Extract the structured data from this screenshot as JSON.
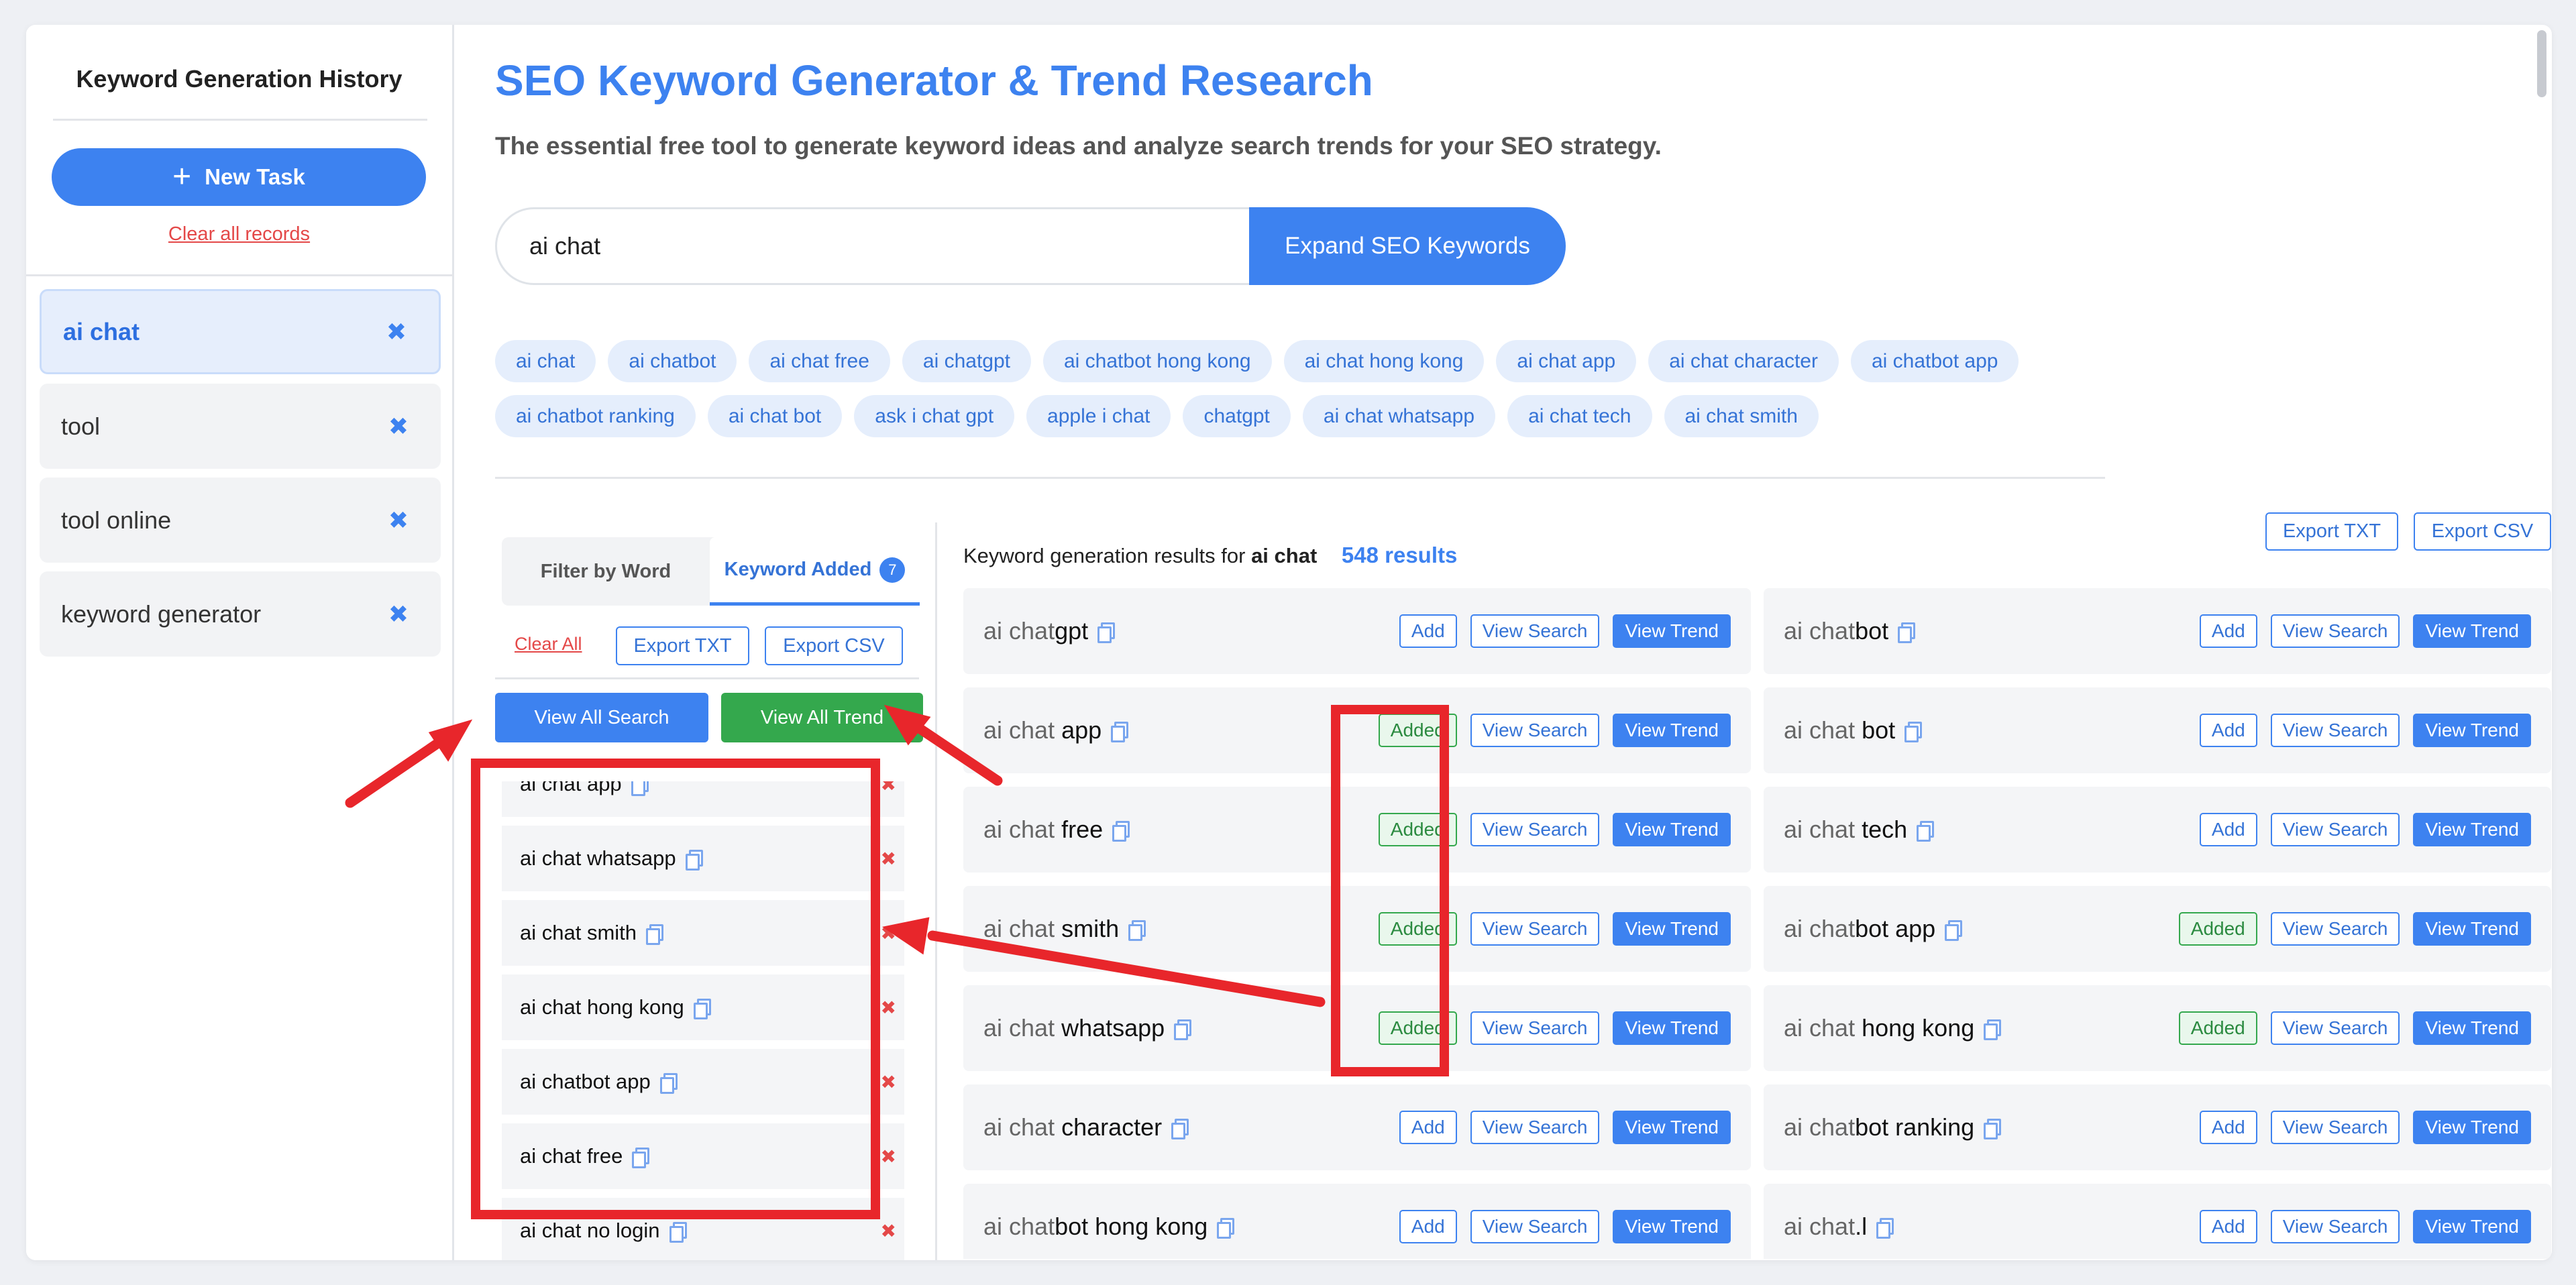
{
  "sidebar": {
    "title": "Keyword Generation History",
    "new_task_label": "New Task",
    "clear_all_label": "Clear all records",
    "items": [
      {
        "label": "ai chat"
      },
      {
        "label": "tool"
      },
      {
        "label": "tool online"
      },
      {
        "label": "keyword generator"
      }
    ]
  },
  "header": {
    "title": "SEO Keyword Generator & Trend Research",
    "subtitle": "The essential free tool to generate keyword ideas and analyze search trends for your SEO strategy."
  },
  "search": {
    "value": "ai chat",
    "button_label": "Expand SEO Keywords"
  },
  "chips": {
    "row1": [
      "ai chat",
      "ai chatbot",
      "ai chat free",
      "ai chatgpt",
      "ai chatbot hong kong",
      "ai chat hong kong",
      "ai chat app",
      "ai chat character",
      "ai chatbot app"
    ],
    "row2": [
      "ai chatbot ranking",
      "ai chat bot",
      "ask i chat gpt",
      "apple i chat",
      "chatgpt",
      "ai chat whatsapp",
      "ai chat tech",
      "ai chat smith"
    ]
  },
  "keyword_panel": {
    "tab_filter": "Filter by Word",
    "tab_added": "Keyword Added",
    "added_count": "7",
    "clear_all": "Clear All",
    "export_txt": "Export TXT",
    "export_csv": "Export CSV",
    "view_all_search": "View All Search",
    "view_all_trend": "View All Trend",
    "added_items": [
      "ai chat app",
      "ai chat whatsapp",
      "ai chat smith",
      "ai chat hong kong",
      "ai chatbot app",
      "ai chat free",
      "ai chat no login"
    ]
  },
  "results": {
    "prefix": "Keyword generation results for",
    "query": "ai chat",
    "count": "548 results",
    "export_txt": "Export TXT",
    "export_csv": "Export CSV",
    "labels": {
      "add": "Add",
      "added": "Added",
      "view_search": "View Search",
      "view_trend": "View Trend"
    },
    "left": [
      {
        "base": "ai chat",
        "rest": "gpt",
        "added": false
      },
      {
        "base": "ai chat",
        "rest": " app",
        "added": true
      },
      {
        "base": "ai chat",
        "rest": " free",
        "added": true
      },
      {
        "base": "ai chat",
        "rest": " smith",
        "added": true
      },
      {
        "base": "ai chat",
        "rest": " whatsapp",
        "added": true
      },
      {
        "base": "ai chat",
        "rest": " character",
        "added": false
      },
      {
        "base": "ai chat",
        "rest": "bot hong kong",
        "added": false
      }
    ],
    "right": [
      {
        "base": "ai chat",
        "rest": "bot",
        "added": false
      },
      {
        "base": "ai chat",
        "rest": " bot",
        "added": false
      },
      {
        "base": "ai chat",
        "rest": " tech",
        "added": false
      },
      {
        "base": "ai chat",
        "rest": "bot app",
        "added": true
      },
      {
        "base": "ai chat",
        "rest": " hong kong",
        "added": true
      },
      {
        "base": "ai chat",
        "rest": "bot ranking",
        "added": false
      },
      {
        "base": "ai chat",
        "rest": ".l",
        "added": false
      }
    ]
  },
  "colors": {
    "accent": "#3d82f0",
    "green": "#34a84d",
    "danger": "#e44848",
    "annotation": "#e8262b"
  }
}
